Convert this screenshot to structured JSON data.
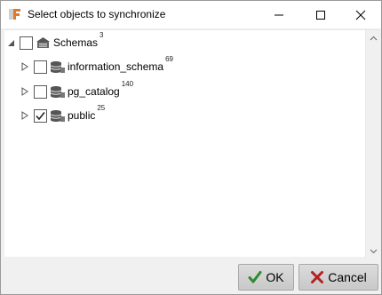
{
  "window": {
    "title": "Select objects to synchronize",
    "minimize_label": "—",
    "maximize_label": "☐",
    "close_label": "✕"
  },
  "tree": {
    "root": {
      "label": "Schemas",
      "count": "3",
      "checked": false,
      "icon": "schemas-folder-icon"
    },
    "children": [
      {
        "label": "information_schema",
        "count": "69",
        "checked": false,
        "icon": "database-schema-icon"
      },
      {
        "label": "pg_catalog",
        "count": "140",
        "checked": false,
        "icon": "database-schema-icon"
      },
      {
        "label": "public",
        "count": "25",
        "checked": true,
        "icon": "database-schema-icon"
      }
    ]
  },
  "buttons": {
    "ok_label": "OK",
    "cancel_label": "Cancel"
  },
  "colors": {
    "ok_check": "#2e8b2e",
    "cancel_x": "#b22222",
    "app_icon": "#e07a2a"
  }
}
